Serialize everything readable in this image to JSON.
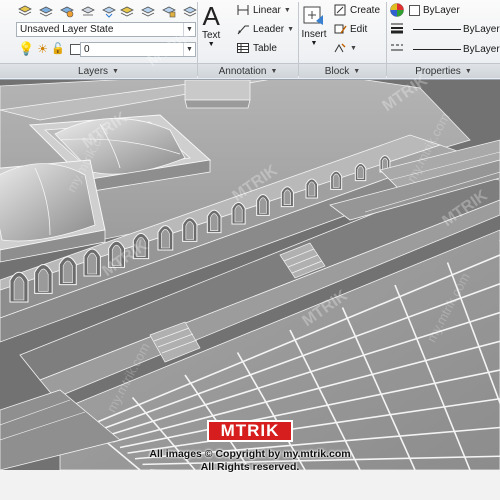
{
  "ribbon": {
    "layers": {
      "title": "Layers",
      "layer_state": "Unsaved Layer State",
      "current_layer": "0"
    },
    "annotation": {
      "title": "Annotation",
      "text_label": "Text",
      "linear_label": "Linear",
      "leader_label": "Leader",
      "table_label": "Table"
    },
    "block": {
      "title": "Block",
      "insert_label": "Insert",
      "create_label": "Create",
      "edit_label": "Edit"
    },
    "properties": {
      "title": "Properties",
      "color": "ByLayer",
      "linetype": "ByLayer",
      "lineweight": "ByLayer"
    }
  },
  "watermark": {
    "brand": "MTRIK",
    "url": "my.mtrik.com",
    "copyright_line1": "All images © Copyright by my.mtrik.com",
    "copyright_line2": "All Rights reserved."
  },
  "colors": {
    "ribbon_bg": "#eef0f3",
    "viewport_bg": "#6f6f6f",
    "model_light": "#c8c8c8",
    "model_mid": "#a3a3a3",
    "model_dark": "#7c7c7c",
    "edges": "#f4f4f4",
    "logo_red": "#d61e1e"
  }
}
